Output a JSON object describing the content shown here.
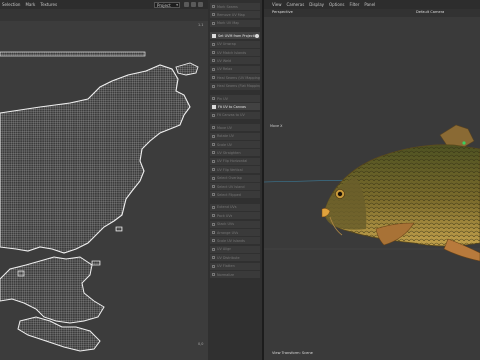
{
  "uv_editor": {
    "menu": [
      "Selection",
      "Mark",
      "Textures"
    ],
    "mode_dropdown": "Project",
    "corner_top": "1.1",
    "corner_bottom": "0,0"
  },
  "tool_panel": {
    "items": [
      {
        "label": "Mark Seams",
        "active": false
      },
      {
        "label": "Remove UV Map",
        "active": false
      },
      {
        "label": "Mark UV Map",
        "active": false
      },
      {
        "label": "Set UVM from Projection",
        "active": true,
        "checked": true,
        "badge": true
      },
      {
        "label": "UV Unwrap",
        "active": false
      },
      {
        "label": "UV Match Islands",
        "active": false
      },
      {
        "label": "UV Weld",
        "active": false
      },
      {
        "label": "UV Relax",
        "active": false
      },
      {
        "label": "Heal Seams (UV Mapping)",
        "active": false
      },
      {
        "label": "Heal Seams (Flat Mapping)",
        "active": false
      },
      {
        "label": "Pin UV",
        "active": false
      },
      {
        "label": "Fit UV to Canvas",
        "active": true,
        "checked": true
      },
      {
        "label": "Fit Canvas to UV",
        "active": false
      },
      {
        "label": "Move UV",
        "active": false
      },
      {
        "label": "Rotate UV",
        "active": false
      },
      {
        "label": "Scale UV",
        "active": false
      },
      {
        "label": "UV Straighten",
        "active": false
      },
      {
        "label": "UV Flip Horizontal",
        "active": false
      },
      {
        "label": "UV Flip Vertical",
        "active": false
      },
      {
        "label": "Select Overlap",
        "active": false
      },
      {
        "label": "Select UV Island",
        "active": false
      },
      {
        "label": "Select Flipped",
        "active": false
      },
      {
        "label": "Extend UVs",
        "active": false
      },
      {
        "label": "Pack UVs",
        "active": false
      },
      {
        "label": "Stack UVs",
        "active": false
      },
      {
        "label": "Arrange UVs",
        "active": false
      },
      {
        "label": "Scale UV Islands",
        "active": false
      },
      {
        "label": "UV Align",
        "active": false
      },
      {
        "label": "UV Distribute",
        "active": false
      },
      {
        "label": "UV Flatten",
        "active": false
      },
      {
        "label": "Normalize",
        "active": false
      }
    ]
  },
  "viewport": {
    "menu": [
      "View",
      "Cameras",
      "Display",
      "Options",
      "Filter",
      "Panel"
    ],
    "perspective_label": "Perspective",
    "camera_label": "Default Camera",
    "side_label": "Move X",
    "status": "View Transform: Scene"
  },
  "colors": {
    "uv_background": "#3c3c3c",
    "uv_wire": "#e8e8e8",
    "viewport_background": "#3a3a3a",
    "fish_body": "#7a6a2e",
    "fish_belly": "#c8a84a",
    "fish_fin": "#b07a3c",
    "axis_blue": "#3aa0d0"
  }
}
